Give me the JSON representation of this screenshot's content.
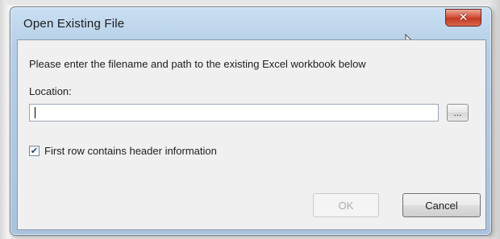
{
  "dialog": {
    "title": "Open Existing File",
    "close_glyph": "✕",
    "instruction": "Please enter the filename and path to the existing Excel workbook below",
    "location_label": "Location:",
    "location_value": "",
    "browse_label": "...",
    "checkbox": {
      "checked": true,
      "label": "First row contains header information"
    },
    "ok_label": "OK",
    "ok_enabled": false,
    "cancel_label": "Cancel"
  },
  "icons": {
    "close": "close-icon",
    "checkmark": "checkmark-icon",
    "cursor": "mouse-pointer-icon"
  },
  "colors": {
    "close_button": "#d6523d",
    "title_bar": "#b6cfe6",
    "client_bg": "#f0f0f0",
    "disabled_text": "#a9adb1"
  }
}
